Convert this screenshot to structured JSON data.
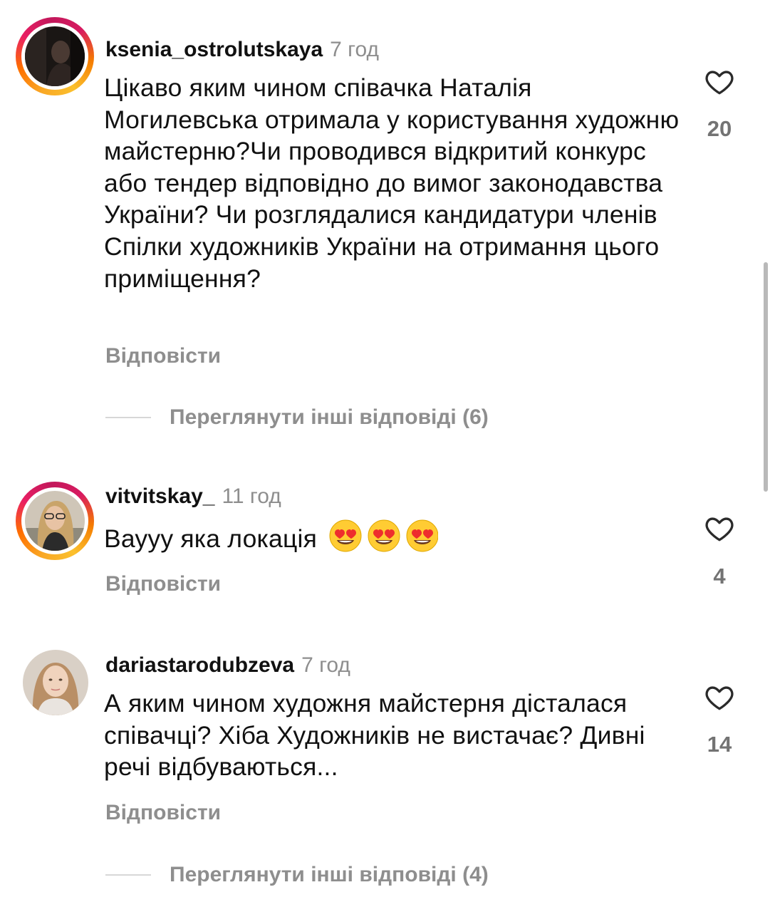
{
  "comments": [
    {
      "username": "ksenia_ostrolutskaya",
      "time": "7 год",
      "text": "Цікаво яким чином співачка Наталія Могилевська отримала у користування художню майстерню?Чи проводився відкритий конкурс або тендер відповідно до вимог законодавства України? Чи розглядалися кандидатури членів Спілки художників України на отримання цього приміщення?",
      "reply_label": "Відповісти",
      "likes": "20",
      "view_replies": "Переглянути інші відповіді (6)"
    },
    {
      "username": "vitvitskay_",
      "time": "11 год",
      "text": "Ваууу яка локація",
      "emoji": "heart-eyes-emoji",
      "reply_label": "Відповісти",
      "likes": "4"
    },
    {
      "username": "dariastarodubzeva",
      "time": "7 год",
      "text": "А яким чином художня майстерня дісталася співачці? Хіба Художників не вистачає? Дивні речі відбуваються...",
      "reply_label": "Відповісти",
      "likes": "14",
      "view_replies": "Переглянути інші відповіді (4)"
    }
  ],
  "icons": {
    "like": "heart-outline-icon"
  },
  "colors": {
    "text": "#111111",
    "secondary": "#8e8e8e",
    "story_ring": "#e91e63"
  }
}
